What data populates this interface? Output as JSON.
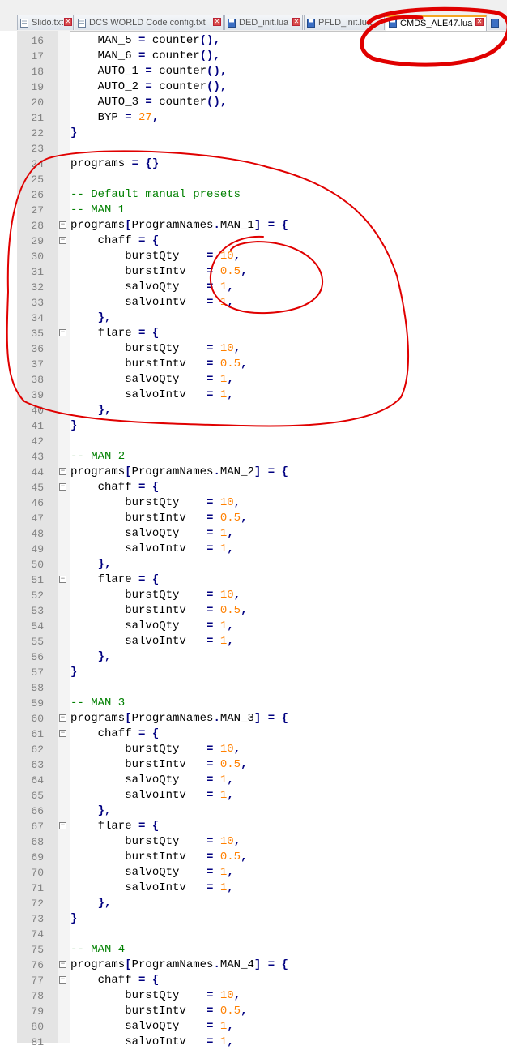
{
  "tabs": [
    {
      "label": "Slido.txt",
      "active": false
    },
    {
      "label": "DCS WORLD Code config.txt",
      "active": false
    },
    {
      "label": "DED_init.lua",
      "active": false
    },
    {
      "label": "PFLD_init.lua",
      "active": false
    },
    {
      "label": "CMDS_ALE47.lua",
      "active": true
    }
  ],
  "colors": {
    "number": "#ff8000",
    "comment": "#008000",
    "operator": "#000080",
    "annotation": "#e00000",
    "active_tab_accent": "#f5a623"
  },
  "lines": [
    {
      "n": "16",
      "text": "    MAN_5 = counter(),"
    },
    {
      "n": "17",
      "text": "    MAN_6 = counter(),"
    },
    {
      "n": "18",
      "text": "    AUTO_1 = counter(),"
    },
    {
      "n": "19",
      "text": "    AUTO_2 = counter(),"
    },
    {
      "n": "20",
      "text": "    AUTO_3 = counter(),"
    },
    {
      "n": "21",
      "text": "    BYP = 27,"
    },
    {
      "n": "22",
      "text": "}"
    },
    {
      "n": "23",
      "text": ""
    },
    {
      "n": "24",
      "text": "programs = {}"
    },
    {
      "n": "25",
      "text": ""
    },
    {
      "n": "26",
      "text": "-- Default manual presets"
    },
    {
      "n": "27",
      "text": "-- MAN 1"
    },
    {
      "n": "28",
      "text": "programs[ProgramNames.MAN_1] = {"
    },
    {
      "n": "29",
      "text": "    chaff = {"
    },
    {
      "n": "30",
      "text": "        burstQty    = 10,"
    },
    {
      "n": "31",
      "text": "        burstIntv   = 0.5,"
    },
    {
      "n": "32",
      "text": "        salvoQty    = 1,"
    },
    {
      "n": "33",
      "text": "        salvoIntv   = 1,"
    },
    {
      "n": "34",
      "text": "    },"
    },
    {
      "n": "35",
      "text": "    flare = {"
    },
    {
      "n": "36",
      "text": "        burstQty    = 10,"
    },
    {
      "n": "37",
      "text": "        burstIntv   = 0.5,"
    },
    {
      "n": "38",
      "text": "        salvoQty    = 1,"
    },
    {
      "n": "39",
      "text": "        salvoIntv   = 1,"
    },
    {
      "n": "40",
      "text": "    },"
    },
    {
      "n": "41",
      "text": "}"
    },
    {
      "n": "42",
      "text": ""
    },
    {
      "n": "43",
      "text": "-- MAN 2"
    },
    {
      "n": "44",
      "text": "programs[ProgramNames.MAN_2] = {"
    },
    {
      "n": "45",
      "text": "    chaff = {"
    },
    {
      "n": "46",
      "text": "        burstQty    = 10,"
    },
    {
      "n": "47",
      "text": "        burstIntv   = 0.5,"
    },
    {
      "n": "48",
      "text": "        salvoQty    = 1,"
    },
    {
      "n": "49",
      "text": "        salvoIntv   = 1,"
    },
    {
      "n": "50",
      "text": "    },"
    },
    {
      "n": "51",
      "text": "    flare = {"
    },
    {
      "n": "52",
      "text": "        burstQty    = 10,"
    },
    {
      "n": "53",
      "text": "        burstIntv   = 0.5,"
    },
    {
      "n": "54",
      "text": "        salvoQty    = 1,"
    },
    {
      "n": "55",
      "text": "        salvoIntv   = 1,"
    },
    {
      "n": "56",
      "text": "    },"
    },
    {
      "n": "57",
      "text": "}"
    },
    {
      "n": "58",
      "text": ""
    },
    {
      "n": "59",
      "text": "-- MAN 3"
    },
    {
      "n": "60",
      "text": "programs[ProgramNames.MAN_3] = {"
    },
    {
      "n": "61",
      "text": "    chaff = {"
    },
    {
      "n": "62",
      "text": "        burstQty    = 10,"
    },
    {
      "n": "63",
      "text": "        burstIntv   = 0.5,"
    },
    {
      "n": "64",
      "text": "        salvoQty    = 1,"
    },
    {
      "n": "65",
      "text": "        salvoIntv   = 1,"
    },
    {
      "n": "66",
      "text": "    },"
    },
    {
      "n": "67",
      "text": "    flare = {"
    },
    {
      "n": "68",
      "text": "        burstQty    = 10,"
    },
    {
      "n": "69",
      "text": "        burstIntv   = 0.5,"
    },
    {
      "n": "70",
      "text": "        salvoQty    = 1,"
    },
    {
      "n": "71",
      "text": "        salvoIntv   = 1,"
    },
    {
      "n": "72",
      "text": "    },"
    },
    {
      "n": "73",
      "text": "}"
    },
    {
      "n": "74",
      "text": ""
    },
    {
      "n": "75",
      "text": "-- MAN 4"
    },
    {
      "n": "76",
      "text": "programs[ProgramNames.MAN_4] = {"
    },
    {
      "n": "77",
      "text": "    chaff = {"
    },
    {
      "n": "78",
      "text": "        burstQty    = 10,"
    },
    {
      "n": "79",
      "text": "        burstIntv   = 0.5,"
    },
    {
      "n": "80",
      "text": "        salvoQty    = 1,"
    },
    {
      "n": "81",
      "text": "        salvoIntv   = 1,"
    }
  ]
}
